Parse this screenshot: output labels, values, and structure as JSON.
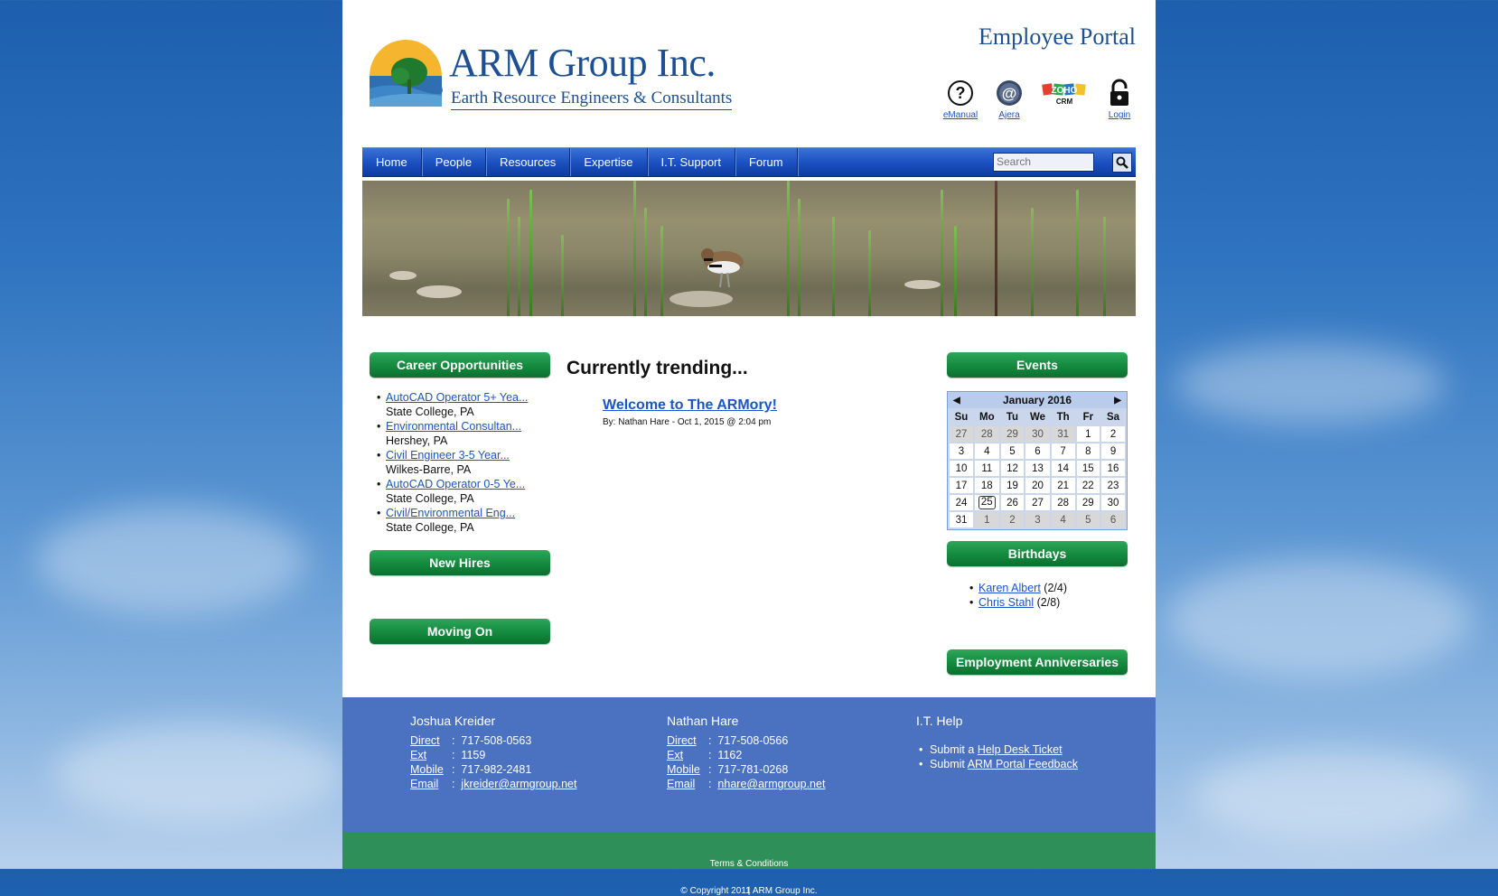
{
  "brand": {
    "name": "ARM Group Inc.",
    "tagline": "Earth Resource Engineers & Consultants",
    "portal_title": "Employee Portal"
  },
  "toplinks": [
    {
      "label": "eManual",
      "icon": "help-icon"
    },
    {
      "label": "Ajera",
      "icon": "ajera-icon"
    },
    {
      "label": "",
      "icon": "zoho-crm-icon"
    },
    {
      "label": "Login",
      "icon": "lock-icon"
    }
  ],
  "zoho": {
    "word": "ZOHO",
    "sub": "CRM"
  },
  "nav": {
    "items": [
      "Home",
      "People",
      "Resources",
      "Expertise",
      "I.T. Support",
      "Forum"
    ],
    "search_placeholder": "Search"
  },
  "left": {
    "career_title": "Career Opportunities",
    "jobs": [
      {
        "title": "AutoCAD Operator 5+ Yea...",
        "location": "State College, PA"
      },
      {
        "title": "Environmental Consultan...",
        "location": "Hershey, PA"
      },
      {
        "title": "Civil Engineer 3-5 Year...",
        "location": "Wilkes-Barre, PA"
      },
      {
        "title": "AutoCAD Operator 0-5 Ye...",
        "location": "State College, PA"
      },
      {
        "title": "Civil/Environmental Eng...",
        "location": "State College, PA"
      }
    ],
    "new_hires_title": "New Hires",
    "moving_on_title": "Moving On"
  },
  "center": {
    "heading": "Currently trending...",
    "post_title": "Welcome to The ARMory!",
    "post_meta": "By: Nathan Hare - Oct 1, 2015 @ 2:04 pm"
  },
  "right": {
    "events_title": "Events",
    "calendar": {
      "month": "January 2016",
      "prev": "◀",
      "next": "▶",
      "weekdays": [
        "Su",
        "Mo",
        "Tu",
        "We",
        "Th",
        "Fr",
        "Sa"
      ],
      "weeks": [
        [
          [
            "27",
            1
          ],
          [
            "28",
            1
          ],
          [
            "29",
            1
          ],
          [
            "30",
            1
          ],
          [
            "31",
            1
          ],
          [
            "1",
            0
          ],
          [
            "2",
            0
          ]
        ],
        [
          [
            "3",
            0
          ],
          [
            "4",
            0
          ],
          [
            "5",
            0
          ],
          [
            "6",
            0
          ],
          [
            "7",
            0
          ],
          [
            "8",
            0
          ],
          [
            "9",
            0
          ]
        ],
        [
          [
            "10",
            0
          ],
          [
            "11",
            0
          ],
          [
            "12",
            0
          ],
          [
            "13",
            0
          ],
          [
            "14",
            0
          ],
          [
            "15",
            0
          ],
          [
            "16",
            0
          ]
        ],
        [
          [
            "17",
            0
          ],
          [
            "18",
            0
          ],
          [
            "19",
            0
          ],
          [
            "20",
            0
          ],
          [
            "21",
            0
          ],
          [
            "22",
            0
          ],
          [
            "23",
            0
          ]
        ],
        [
          [
            "24",
            0
          ],
          [
            "25",
            2
          ],
          [
            "26",
            0
          ],
          [
            "27",
            0
          ],
          [
            "28",
            0
          ],
          [
            "29",
            0
          ],
          [
            "30",
            0
          ]
        ],
        [
          [
            "31",
            0
          ],
          [
            "1",
            1
          ],
          [
            "2",
            1
          ],
          [
            "3",
            1
          ],
          [
            "4",
            1
          ],
          [
            "5",
            1
          ],
          [
            "6",
            1
          ]
        ]
      ]
    },
    "birthdays_title": "Birthdays",
    "birthdays": [
      {
        "name": "Karen Albert",
        "date": "(2/4)"
      },
      {
        "name": "Chris Stahl",
        "date": "(2/8)"
      }
    ],
    "anniversaries_title": "Employment Anniversaries"
  },
  "footer": {
    "contacts": [
      {
        "name": "Joshua Kreider",
        "direct": "717-508-0563",
        "ext": "1159",
        "mobile": "717-982-2481",
        "email": "jkreider@armgroup.net"
      },
      {
        "name": "Nathan Hare",
        "direct": "717-508-0566",
        "ext": "1162",
        "mobile": "717-781-0268",
        "email": "nhare@armgroup.net"
      }
    ],
    "labels": {
      "direct": "Direct",
      "ext": "Ext",
      "mobile": "Mobile",
      "email": "Email"
    },
    "it_help": {
      "title": "I.T. Help",
      "items": [
        {
          "prefix": "Submit a ",
          "link": "Help Desk Ticket"
        },
        {
          "prefix": "Submit ",
          "link": "ARM Portal Feedback"
        }
      ]
    },
    "copyright": "© Copyright 2011 ARM Group Inc.",
    "separator": "|",
    "terms": "Terms & Conditions"
  },
  "colors": {
    "brand_blue": "#1d4f95",
    "nav_blue": "#1a4fbf",
    "green_button": "#138a3d",
    "footer_blue": "#4b72c0",
    "footer_green": "#2f8f59",
    "link": "#1a55c9"
  }
}
